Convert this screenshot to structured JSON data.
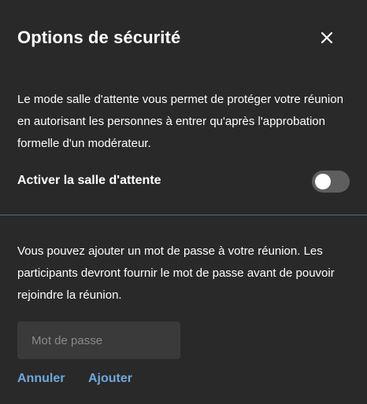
{
  "dialog": {
    "title": "Options de sécurité",
    "close_icon": "close-icon"
  },
  "lobby": {
    "description": "Le mode salle d'attente vous permet de protéger votre réunion en autorisant les personnes à entrer qu'après l'approbation formelle d'un modérateur.",
    "toggle_label": "Activer la salle d'attente",
    "toggle_enabled": false
  },
  "password": {
    "description": "Vous pouvez ajouter un mot de passe à votre réunion. Les participants devront fournir le mot de passe avant de pouvoir rejoindre la réunion.",
    "input_value": "",
    "placeholder": "Mot de passe",
    "cancel_label": "Annuler",
    "add_label": "Ajouter"
  },
  "colors": {
    "background": "#292929",
    "link": "#6ea8dc",
    "toggle_off": "#5e5e5e",
    "divider": "#5a6a78"
  }
}
